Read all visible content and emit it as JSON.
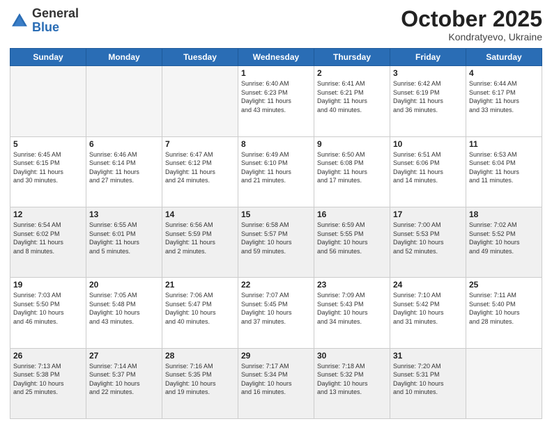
{
  "header": {
    "logo_general": "General",
    "logo_blue": "Blue",
    "month_title": "October 2025",
    "subtitle": "Kondratyevo, Ukraine"
  },
  "weekdays": [
    "Sunday",
    "Monday",
    "Tuesday",
    "Wednesday",
    "Thursday",
    "Friday",
    "Saturday"
  ],
  "weeks": [
    [
      {
        "day": "",
        "info": "",
        "empty": true
      },
      {
        "day": "",
        "info": "",
        "empty": true
      },
      {
        "day": "",
        "info": "",
        "empty": true
      },
      {
        "day": "1",
        "info": "Sunrise: 6:40 AM\nSunset: 6:23 PM\nDaylight: 11 hours\nand 43 minutes."
      },
      {
        "day": "2",
        "info": "Sunrise: 6:41 AM\nSunset: 6:21 PM\nDaylight: 11 hours\nand 40 minutes."
      },
      {
        "day": "3",
        "info": "Sunrise: 6:42 AM\nSunset: 6:19 PM\nDaylight: 11 hours\nand 36 minutes."
      },
      {
        "day": "4",
        "info": "Sunrise: 6:44 AM\nSunset: 6:17 PM\nDaylight: 11 hours\nand 33 minutes."
      }
    ],
    [
      {
        "day": "5",
        "info": "Sunrise: 6:45 AM\nSunset: 6:15 PM\nDaylight: 11 hours\nand 30 minutes."
      },
      {
        "day": "6",
        "info": "Sunrise: 6:46 AM\nSunset: 6:14 PM\nDaylight: 11 hours\nand 27 minutes."
      },
      {
        "day": "7",
        "info": "Sunrise: 6:47 AM\nSunset: 6:12 PM\nDaylight: 11 hours\nand 24 minutes."
      },
      {
        "day": "8",
        "info": "Sunrise: 6:49 AM\nSunset: 6:10 PM\nDaylight: 11 hours\nand 21 minutes."
      },
      {
        "day": "9",
        "info": "Sunrise: 6:50 AM\nSunset: 6:08 PM\nDaylight: 11 hours\nand 17 minutes."
      },
      {
        "day": "10",
        "info": "Sunrise: 6:51 AM\nSunset: 6:06 PM\nDaylight: 11 hours\nand 14 minutes."
      },
      {
        "day": "11",
        "info": "Sunrise: 6:53 AM\nSunset: 6:04 PM\nDaylight: 11 hours\nand 11 minutes."
      }
    ],
    [
      {
        "day": "12",
        "info": "Sunrise: 6:54 AM\nSunset: 6:02 PM\nDaylight: 11 hours\nand 8 minutes.",
        "shaded": true
      },
      {
        "day": "13",
        "info": "Sunrise: 6:55 AM\nSunset: 6:01 PM\nDaylight: 11 hours\nand 5 minutes.",
        "shaded": true
      },
      {
        "day": "14",
        "info": "Sunrise: 6:56 AM\nSunset: 5:59 PM\nDaylight: 11 hours\nand 2 minutes.",
        "shaded": true
      },
      {
        "day": "15",
        "info": "Sunrise: 6:58 AM\nSunset: 5:57 PM\nDaylight: 10 hours\nand 59 minutes.",
        "shaded": true
      },
      {
        "day": "16",
        "info": "Sunrise: 6:59 AM\nSunset: 5:55 PM\nDaylight: 10 hours\nand 56 minutes.",
        "shaded": true
      },
      {
        "day": "17",
        "info": "Sunrise: 7:00 AM\nSunset: 5:53 PM\nDaylight: 10 hours\nand 52 minutes.",
        "shaded": true
      },
      {
        "day": "18",
        "info": "Sunrise: 7:02 AM\nSunset: 5:52 PM\nDaylight: 10 hours\nand 49 minutes.",
        "shaded": true
      }
    ],
    [
      {
        "day": "19",
        "info": "Sunrise: 7:03 AM\nSunset: 5:50 PM\nDaylight: 10 hours\nand 46 minutes."
      },
      {
        "day": "20",
        "info": "Sunrise: 7:05 AM\nSunset: 5:48 PM\nDaylight: 10 hours\nand 43 minutes."
      },
      {
        "day": "21",
        "info": "Sunrise: 7:06 AM\nSunset: 5:47 PM\nDaylight: 10 hours\nand 40 minutes."
      },
      {
        "day": "22",
        "info": "Sunrise: 7:07 AM\nSunset: 5:45 PM\nDaylight: 10 hours\nand 37 minutes."
      },
      {
        "day": "23",
        "info": "Sunrise: 7:09 AM\nSunset: 5:43 PM\nDaylight: 10 hours\nand 34 minutes."
      },
      {
        "day": "24",
        "info": "Sunrise: 7:10 AM\nSunset: 5:42 PM\nDaylight: 10 hours\nand 31 minutes."
      },
      {
        "day": "25",
        "info": "Sunrise: 7:11 AM\nSunset: 5:40 PM\nDaylight: 10 hours\nand 28 minutes."
      }
    ],
    [
      {
        "day": "26",
        "info": "Sunrise: 7:13 AM\nSunset: 5:38 PM\nDaylight: 10 hours\nand 25 minutes.",
        "shaded": true
      },
      {
        "day": "27",
        "info": "Sunrise: 7:14 AM\nSunset: 5:37 PM\nDaylight: 10 hours\nand 22 minutes.",
        "shaded": true
      },
      {
        "day": "28",
        "info": "Sunrise: 7:16 AM\nSunset: 5:35 PM\nDaylight: 10 hours\nand 19 minutes.",
        "shaded": true
      },
      {
        "day": "29",
        "info": "Sunrise: 7:17 AM\nSunset: 5:34 PM\nDaylight: 10 hours\nand 16 minutes.",
        "shaded": true
      },
      {
        "day": "30",
        "info": "Sunrise: 7:18 AM\nSunset: 5:32 PM\nDaylight: 10 hours\nand 13 minutes.",
        "shaded": true
      },
      {
        "day": "31",
        "info": "Sunrise: 7:20 AM\nSunset: 5:31 PM\nDaylight: 10 hours\nand 10 minutes.",
        "shaded": true
      },
      {
        "day": "",
        "info": "",
        "empty": true,
        "shaded": true
      }
    ]
  ]
}
